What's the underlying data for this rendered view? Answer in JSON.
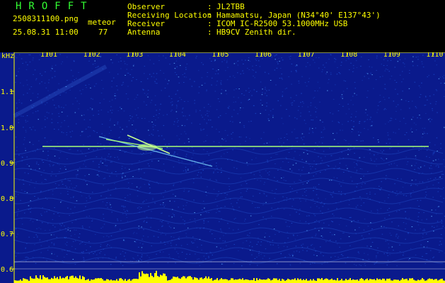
{
  "header": {
    "title": "HROFFT",
    "filename": "2508311100.png",
    "datetime": "25.08.31 11:00",
    "meteor_label": "meteor",
    "meteor_count": "77",
    "info": [
      {
        "key": "Observer",
        "value": "JL2TBB"
      },
      {
        "key": "Receiving Location",
        "value": "Hamamatsu, Japan (N34°40' E137°43')"
      },
      {
        "key": "Receiver",
        "value": "ICOM IC-R2500 53.1000MHz USB"
      },
      {
        "key": "Antenna",
        "value": "HB9CV Zenith dir."
      }
    ]
  },
  "spectrogram": {
    "y_unit": "kHz",
    "y_ticks": [
      "1.1",
      "1.0",
      "0.9",
      "0.8",
      "0.7",
      "0.6"
    ],
    "x_ticks": [
      "1101",
      "1102",
      "1103",
      "1104",
      "1105",
      "1106",
      "1107",
      "1108",
      "1109",
      "1110"
    ],
    "colors": {
      "background": "#0a1a8c",
      "speckle": "#1e50d2",
      "signal": "#a8ff78",
      "axis": "#ffff00",
      "level": "#ffff00"
    }
  }
}
